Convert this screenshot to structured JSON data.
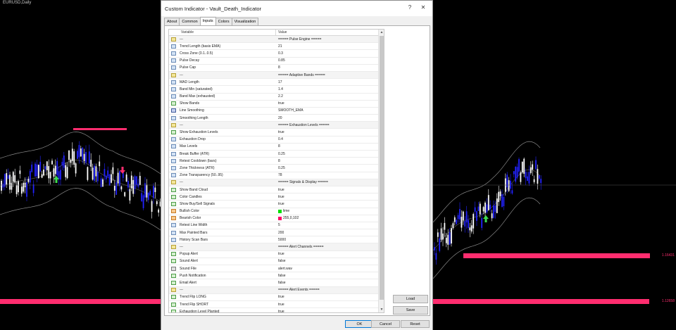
{
  "chart": {
    "symbol": "EURUSD,Daily",
    "price_tags": [
      "1.16431",
      "1.12658"
    ],
    "colors": {
      "background": "#000000",
      "bull": "#2222ff",
      "bear": "#ffffff",
      "accent": "#ff2d6f",
      "signal_up": "#3fdc4f"
    }
  },
  "dialog": {
    "title": "Custom Indicator - Vault_Death_Indicator",
    "help": "?",
    "close": "✕",
    "tabs": [
      "About",
      "Common",
      "Inputs",
      "Colors",
      "Visualization"
    ],
    "active_tab": "Inputs",
    "columns": {
      "variable": "Variable",
      "value": "Value"
    },
    "rows": [
      {
        "type": "sep",
        "name": "---",
        "value": "===== Pulse Engine ====="
      },
      {
        "type": "int",
        "name": "Trend Length (basis EMA)",
        "value": "21"
      },
      {
        "type": "dbl",
        "name": "Cross Zone (0.1..0.5)",
        "value": "0.3"
      },
      {
        "type": "dbl",
        "name": "Pulse Decay",
        "value": "0.85"
      },
      {
        "type": "int",
        "name": "Pulse Cap",
        "value": "8"
      },
      {
        "type": "sep",
        "name": "---",
        "value": "===== Adaptive Bands ====="
      },
      {
        "type": "int",
        "name": "MAD Length",
        "value": "17"
      },
      {
        "type": "dbl",
        "name": "Band Min (saturated)",
        "value": "1.4"
      },
      {
        "type": "dbl",
        "name": "Band Max (exhausted)",
        "value": "2.2"
      },
      {
        "type": "bool",
        "name": "Show Bands",
        "value": "true"
      },
      {
        "type": "enum",
        "name": "Line Smoothing",
        "value": "SMOOTH_EMA"
      },
      {
        "type": "int",
        "name": "Smoothing Length",
        "value": "20"
      },
      {
        "type": "sep",
        "name": "---",
        "value": "===== Exhaustion Levels ====="
      },
      {
        "type": "bool",
        "name": "Show Exhaustion Levels",
        "value": "true"
      },
      {
        "type": "dbl",
        "name": "Exhaustion Drop",
        "value": "0.4"
      },
      {
        "type": "int",
        "name": "Max Levels",
        "value": "8"
      },
      {
        "type": "dbl",
        "name": "Break Buffer (ATR)",
        "value": "0.25"
      },
      {
        "type": "int",
        "name": "Retest Cooldown (bars)",
        "value": "8"
      },
      {
        "type": "dbl",
        "name": "Zone Thickness (ATR)",
        "value": "0.25"
      },
      {
        "type": "int",
        "name": "Zone Transparency (50..95)",
        "value": "78"
      },
      {
        "type": "sep",
        "name": "---",
        "value": "===== Signals & Display ====="
      },
      {
        "type": "bool",
        "name": "Show Band Cloud",
        "value": "true"
      },
      {
        "type": "bool",
        "name": "Color Candles",
        "value": "true"
      },
      {
        "type": "bool",
        "name": "Show Buy/Sell Signals",
        "value": "true"
      },
      {
        "type": "color",
        "name": "Bullish Color",
        "value": "lime",
        "swatch": "#00e000"
      },
      {
        "type": "color",
        "name": "Bearish Color",
        "value": "255,0,102",
        "swatch": "#ff0066"
      },
      {
        "type": "int",
        "name": "Retest Line Width",
        "value": "5"
      },
      {
        "type": "int",
        "name": "Max Painted Bars",
        "value": "200"
      },
      {
        "type": "int",
        "name": "History Scan Bars",
        "value": "5000"
      },
      {
        "type": "sep",
        "name": "---",
        "value": "===== Alert Channels ====="
      },
      {
        "type": "bool",
        "name": "Popup Alert",
        "value": "true"
      },
      {
        "type": "bool",
        "name": "Sound Alert",
        "value": "false"
      },
      {
        "type": "str",
        "name": "Sound File",
        "value": "alert.wav"
      },
      {
        "type": "bool",
        "name": "Push Notification",
        "value": "false"
      },
      {
        "type": "bool",
        "name": "Email Alert",
        "value": "false"
      },
      {
        "type": "sep",
        "name": "---",
        "value": "===== Alert Events ====="
      },
      {
        "type": "bool",
        "name": "Trend Flip LONG",
        "value": "true"
      },
      {
        "type": "bool",
        "name": "Trend Flip SHORT",
        "value": "true"
      },
      {
        "type": "bool",
        "name": "Exhaustion Level Planted",
        "value": "true"
      }
    ],
    "buttons": {
      "load": "Load",
      "save": "Save",
      "ok": "OK",
      "cancel": "Cancel",
      "reset": "Reset"
    }
  }
}
